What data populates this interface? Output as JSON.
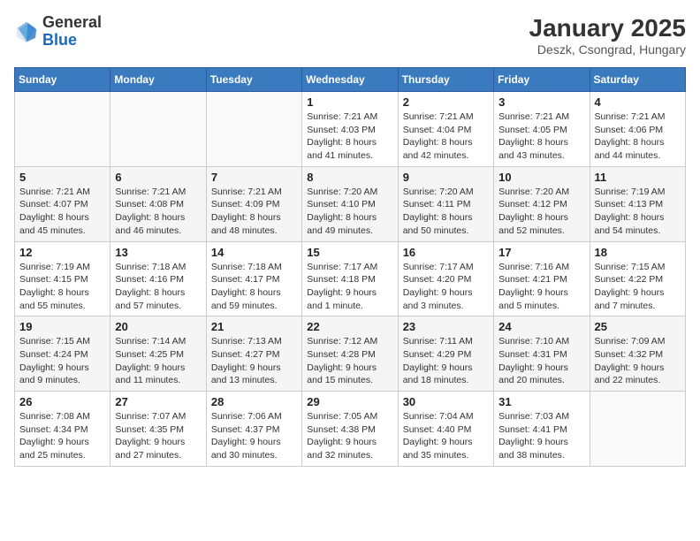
{
  "logo": {
    "general": "General",
    "blue": "Blue"
  },
  "calendar": {
    "title": "January 2025",
    "subtitle": "Deszk, Csongrad, Hungary",
    "days_header": [
      "Sunday",
      "Monday",
      "Tuesday",
      "Wednesday",
      "Thursday",
      "Friday",
      "Saturday"
    ],
    "weeks": [
      [
        {
          "day": "",
          "info": ""
        },
        {
          "day": "",
          "info": ""
        },
        {
          "day": "",
          "info": ""
        },
        {
          "day": "1",
          "info": "Sunrise: 7:21 AM\nSunset: 4:03 PM\nDaylight: 8 hours and 41 minutes."
        },
        {
          "day": "2",
          "info": "Sunrise: 7:21 AM\nSunset: 4:04 PM\nDaylight: 8 hours and 42 minutes."
        },
        {
          "day": "3",
          "info": "Sunrise: 7:21 AM\nSunset: 4:05 PM\nDaylight: 8 hours and 43 minutes."
        },
        {
          "day": "4",
          "info": "Sunrise: 7:21 AM\nSunset: 4:06 PM\nDaylight: 8 hours and 44 minutes."
        }
      ],
      [
        {
          "day": "5",
          "info": "Sunrise: 7:21 AM\nSunset: 4:07 PM\nDaylight: 8 hours and 45 minutes."
        },
        {
          "day": "6",
          "info": "Sunrise: 7:21 AM\nSunset: 4:08 PM\nDaylight: 8 hours and 46 minutes."
        },
        {
          "day": "7",
          "info": "Sunrise: 7:21 AM\nSunset: 4:09 PM\nDaylight: 8 hours and 48 minutes."
        },
        {
          "day": "8",
          "info": "Sunrise: 7:20 AM\nSunset: 4:10 PM\nDaylight: 8 hours and 49 minutes."
        },
        {
          "day": "9",
          "info": "Sunrise: 7:20 AM\nSunset: 4:11 PM\nDaylight: 8 hours and 50 minutes."
        },
        {
          "day": "10",
          "info": "Sunrise: 7:20 AM\nSunset: 4:12 PM\nDaylight: 8 hours and 52 minutes."
        },
        {
          "day": "11",
          "info": "Sunrise: 7:19 AM\nSunset: 4:13 PM\nDaylight: 8 hours and 54 minutes."
        }
      ],
      [
        {
          "day": "12",
          "info": "Sunrise: 7:19 AM\nSunset: 4:15 PM\nDaylight: 8 hours and 55 minutes."
        },
        {
          "day": "13",
          "info": "Sunrise: 7:18 AM\nSunset: 4:16 PM\nDaylight: 8 hours and 57 minutes."
        },
        {
          "day": "14",
          "info": "Sunrise: 7:18 AM\nSunset: 4:17 PM\nDaylight: 8 hours and 59 minutes."
        },
        {
          "day": "15",
          "info": "Sunrise: 7:17 AM\nSunset: 4:18 PM\nDaylight: 9 hours and 1 minute."
        },
        {
          "day": "16",
          "info": "Sunrise: 7:17 AM\nSunset: 4:20 PM\nDaylight: 9 hours and 3 minutes."
        },
        {
          "day": "17",
          "info": "Sunrise: 7:16 AM\nSunset: 4:21 PM\nDaylight: 9 hours and 5 minutes."
        },
        {
          "day": "18",
          "info": "Sunrise: 7:15 AM\nSunset: 4:22 PM\nDaylight: 9 hours and 7 minutes."
        }
      ],
      [
        {
          "day": "19",
          "info": "Sunrise: 7:15 AM\nSunset: 4:24 PM\nDaylight: 9 hours and 9 minutes."
        },
        {
          "day": "20",
          "info": "Sunrise: 7:14 AM\nSunset: 4:25 PM\nDaylight: 9 hours and 11 minutes."
        },
        {
          "day": "21",
          "info": "Sunrise: 7:13 AM\nSunset: 4:27 PM\nDaylight: 9 hours and 13 minutes."
        },
        {
          "day": "22",
          "info": "Sunrise: 7:12 AM\nSunset: 4:28 PM\nDaylight: 9 hours and 15 minutes."
        },
        {
          "day": "23",
          "info": "Sunrise: 7:11 AM\nSunset: 4:29 PM\nDaylight: 9 hours and 18 minutes."
        },
        {
          "day": "24",
          "info": "Sunrise: 7:10 AM\nSunset: 4:31 PM\nDaylight: 9 hours and 20 minutes."
        },
        {
          "day": "25",
          "info": "Sunrise: 7:09 AM\nSunset: 4:32 PM\nDaylight: 9 hours and 22 minutes."
        }
      ],
      [
        {
          "day": "26",
          "info": "Sunrise: 7:08 AM\nSunset: 4:34 PM\nDaylight: 9 hours and 25 minutes."
        },
        {
          "day": "27",
          "info": "Sunrise: 7:07 AM\nSunset: 4:35 PM\nDaylight: 9 hours and 27 minutes."
        },
        {
          "day": "28",
          "info": "Sunrise: 7:06 AM\nSunset: 4:37 PM\nDaylight: 9 hours and 30 minutes."
        },
        {
          "day": "29",
          "info": "Sunrise: 7:05 AM\nSunset: 4:38 PM\nDaylight: 9 hours and 32 minutes."
        },
        {
          "day": "30",
          "info": "Sunrise: 7:04 AM\nSunset: 4:40 PM\nDaylight: 9 hours and 35 minutes."
        },
        {
          "day": "31",
          "info": "Sunrise: 7:03 AM\nSunset: 4:41 PM\nDaylight: 9 hours and 38 minutes."
        },
        {
          "day": "",
          "info": ""
        }
      ]
    ]
  }
}
